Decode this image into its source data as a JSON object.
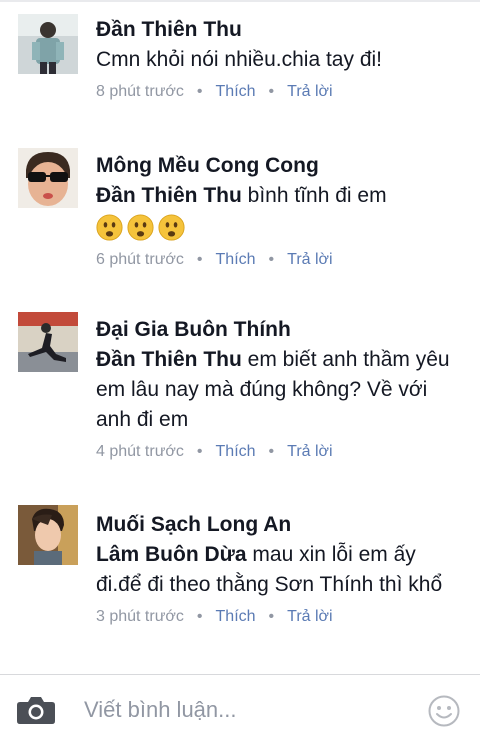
{
  "comments": [
    {
      "author": "Đần Thiên Thu",
      "tag": "",
      "text": "Cmn khỏi nói nhiều.chia tay đi!",
      "time": "8 phút trước",
      "like": "Thích",
      "reply": "Trả lời"
    },
    {
      "author": "Mông Mều Cong Cong",
      "tag": "Đần Thiên Thu",
      "text": " bình tĩnh đi em",
      "emoji": [
        "frowning-face-emoji",
        "frowning-face-emoji",
        "frowning-face-emoji"
      ],
      "time": "6 phút trước",
      "like": "Thích",
      "reply": "Trả lời"
    },
    {
      "author": "Đại Gia Buôn Thính",
      "tag": "Đần Thiên Thu",
      "text": " em biết anh thầm yêu em lâu nay mà đúng không? Về với anh đi em",
      "time": "4 phút trước",
      "like": "Thích",
      "reply": "Trả lời"
    },
    {
      "author": "Muối Sạch Long An",
      "tag": "Lâm Buôn Dừa",
      "text": " mau xin lỗi em ấy đi.để đi theo thằng Sơn Thính thì khổ",
      "time": "3 phút trước",
      "like": "Thích",
      "reply": "Trả lời"
    }
  ],
  "composer": {
    "placeholder": "Viết bình luận...",
    "camera_icon": "camera-icon",
    "emoji_icon": "smiley-icon"
  },
  "colors": {
    "name": "#141823",
    "meta": "#9197a3",
    "action": "#5b7bb4",
    "emoji": "#f5c33b"
  }
}
